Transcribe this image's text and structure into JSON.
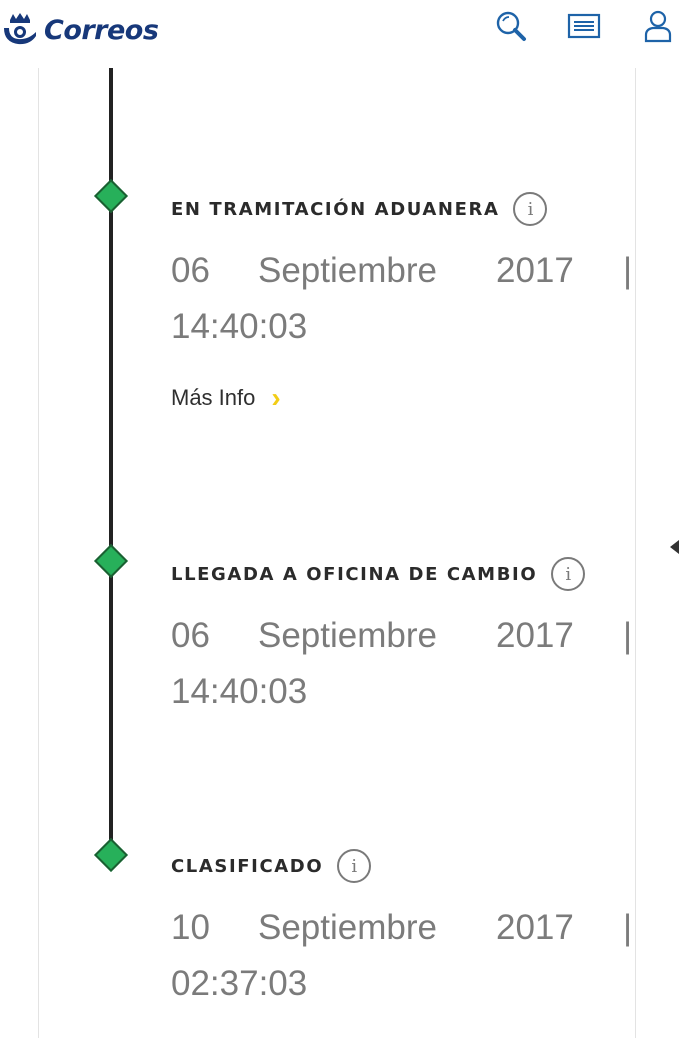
{
  "header": {
    "brand": "Correos",
    "icons": [
      "search-icon",
      "list-icon",
      "user-icon"
    ]
  },
  "events": [
    {
      "status": "EN TRAMITACIÓN ADUANERA",
      "day": "06",
      "month": "Septiembre",
      "year": "2017",
      "separator": "|",
      "time": "14:40:03",
      "more_info": "Más Info"
    },
    {
      "status": "LLEGADA A OFICINA DE CAMBIO",
      "day": "06",
      "month": "Septiembre",
      "year": "2017",
      "separator": "|",
      "time": "14:40:03"
    },
    {
      "status": "CLASIFICADO",
      "day": "10",
      "month": "Septiembre",
      "year": "2017",
      "separator": "|",
      "time": "02:37:03"
    }
  ],
  "colors": {
    "brand_blue": "#17387a",
    "node_green": "#27b05a",
    "chevron_yellow": "#f2cd16",
    "text_gray": "#7b7b7b"
  }
}
